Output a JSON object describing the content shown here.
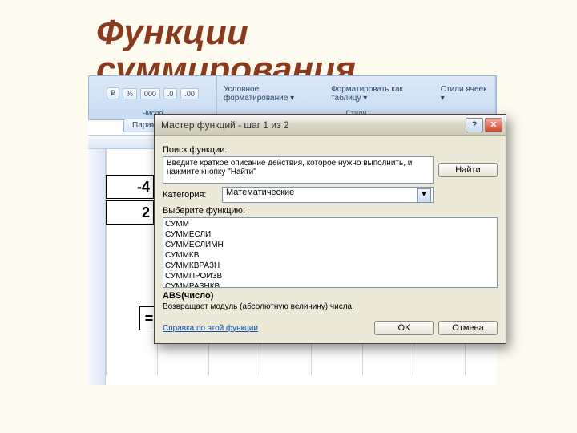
{
  "slide": {
    "title_line1": "Функции",
    "title_line2": "суммирования"
  },
  "ribbon": {
    "number_group": "Число",
    "styles_group": "Стили",
    "btn_currency": "₽",
    "btn_percent": "%",
    "btn_comma": "000",
    "btn_inc": ".0",
    "btn_dec": ".00",
    "btn_condfmt": "Условное форматирование ▾",
    "btn_fmttable": "Форматировать как таблицу ▾",
    "btn_cellstyles": "Стили ячеек ▾"
  },
  "sheet": {
    "param_tab": "Парам",
    "cell_a1": "-4",
    "cell_a2": "2",
    "cell_formula": "="
  },
  "dialog": {
    "title": "Мастер функций - шаг 1 из 2",
    "search_label": "Поиск функции:",
    "search_text": "Введите краткое описание действия, которое нужно выполнить, и нажмите кнопку \"Найти\"",
    "find_btn": "Найти",
    "category_label": "Категория:",
    "category_value": "Математические",
    "select_label": "Выберите функцию:",
    "functions": [
      "СУММ",
      "СУММЕСЛИ",
      "СУММЕСЛИМН",
      "СУММКВ",
      "СУММКВРАЗН",
      "СУММПРОИЗВ",
      "СУММРАЗНКВ"
    ],
    "func_sig": "ABS(число)",
    "func_desc": "Возвращает модуль (абсолютную величину) числа.",
    "help_link": "Справка по этой функции",
    "ok_btn": "ОК",
    "cancel_btn": "Отмена"
  }
}
